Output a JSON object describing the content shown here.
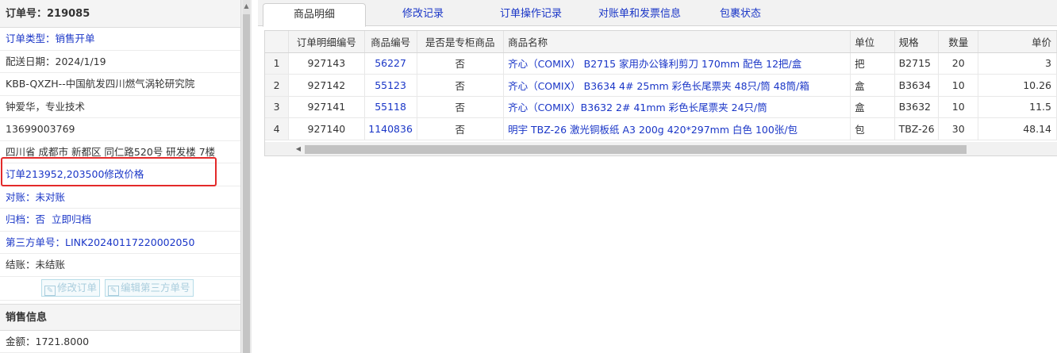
{
  "order": {
    "title": "订单号：219085",
    "type_label": "订单类型：",
    "type_value": "销售开单",
    "delivery": "配送日期：2024/1/19",
    "customer": "KBB-QXZH--中国航发四川燃气涡轮研究院",
    "contact": "钟爱华，专业技术",
    "phone": "13699003769",
    "address": "四川省 成都市 新都区 同仁路520号 研发楼 7楼",
    "note": "订单213952,203500修改价格",
    "reconcile_label": "对账：",
    "reconcile_value": "未对账",
    "archive_label": "归档：",
    "archive_value": "否",
    "archive_action": "立即归档",
    "thirdparty_label": "第三方单号：",
    "thirdparty_value": "LINK20240117220002050",
    "settle": "结账：未结账",
    "btn_edit_order": "修改订单",
    "btn_edit_thirdparty": "编辑第三方单号",
    "sales_section": "销售信息",
    "amount": "金额：1721.8000"
  },
  "tabs": [
    {
      "label": "商品明细",
      "active": true
    },
    {
      "label": "修改记录",
      "active": false
    },
    {
      "label": "订单操作记录",
      "active": false
    },
    {
      "label": "对账单和发票信息",
      "active": false
    },
    {
      "label": "包裹状态",
      "active": false
    }
  ],
  "grid": {
    "columns": [
      "",
      "订单明细编号",
      "商品编号",
      "是否是专柜商品",
      "商品名称",
      "单位",
      "规格",
      "数量",
      "单价"
    ],
    "rows": [
      {
        "idx": "1",
        "detail_id": "927143",
        "sku": "56227",
        "special": "否",
        "name": "齐心（COMIX） B2715 家用办公锋利剪刀 170mm 配色 12把/盒",
        "unit": "把",
        "spec": "B2715",
        "qty": "20",
        "price": "3"
      },
      {
        "idx": "2",
        "detail_id": "927142",
        "sku": "55123",
        "special": "否",
        "name": "齐心（COMIX） B3634 4# 25mm 彩色长尾票夹 48只/筒 48筒/箱",
        "unit": "盒",
        "spec": "B3634",
        "qty": "10",
        "price": "10.26"
      },
      {
        "idx": "3",
        "detail_id": "927141",
        "sku": "55118",
        "special": "否",
        "name": "齐心（COMIX）B3632 2# 41mm 彩色长尾票夹 24只/筒",
        "unit": "盒",
        "spec": "B3632",
        "qty": "10",
        "price": "11.5"
      },
      {
        "idx": "4",
        "detail_id": "927140",
        "sku": "1140836",
        "special": "否",
        "name": "明宇 TBZ-26 激光铜板纸 A3 200g 420*297mm 白色 100张/包",
        "unit": "包",
        "spec": "TBZ-26",
        "qty": "30",
        "price": "48.14"
      }
    ]
  },
  "colors": {
    "link": "#1a36c7",
    "highlight_box": "#e32a2a",
    "header_bg": "#f4f4f4"
  },
  "icons": {
    "edit": "pencil-icon",
    "scroll_left": "triangle-left-icon",
    "scroll_up": "triangle-up-icon"
  }
}
